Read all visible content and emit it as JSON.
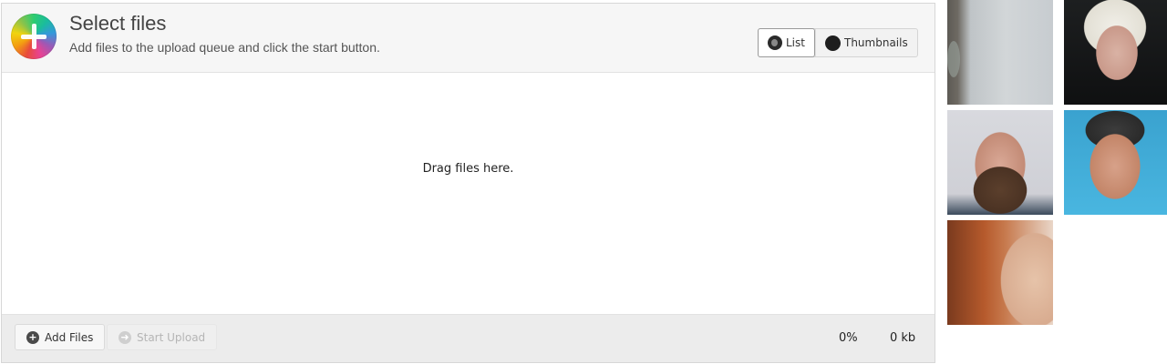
{
  "uploader": {
    "title": "Select files",
    "subtitle": "Add files to the upload queue and click the start button.",
    "view_toggle": {
      "list_label": "List",
      "thumbnails_label": "Thumbnails",
      "active": "List"
    },
    "dropzone_text": "Drag files here.",
    "footer": {
      "add_files_label": "Add Files",
      "start_upload_label": "Start Upload",
      "progress_percent": "0%",
      "total_size": "0 kb"
    }
  },
  "gallery": {
    "images": [
      {
        "icon": "cat-photo"
      },
      {
        "icon": "woman-blonde-photo"
      },
      {
        "icon": "bearded-man-photo"
      },
      {
        "icon": "smiling-man-photo"
      },
      {
        "icon": "redhead-woman-photo"
      }
    ]
  }
}
